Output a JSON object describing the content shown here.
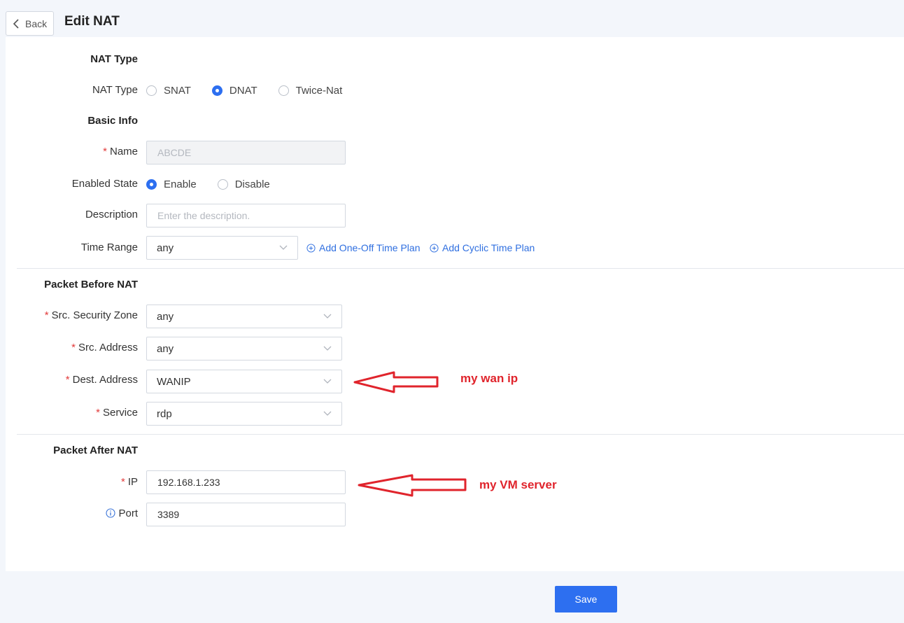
{
  "header": {
    "back_label": "Back",
    "title": "Edit NAT"
  },
  "nat_type_section": {
    "title": "NAT Type",
    "field_label": "NAT Type",
    "options": [
      "SNAT",
      "DNAT",
      "Twice-Nat"
    ],
    "selected": "DNAT"
  },
  "basic_info": {
    "title": "Basic Info",
    "name_label": "Name",
    "name_value": "ABCDE",
    "enabled_label": "Enabled State",
    "enabled_options": [
      "Enable",
      "Disable"
    ],
    "enabled_selected": "Enable",
    "description_label": "Description",
    "description_placeholder": "Enter the description.",
    "time_range_label": "Time Range",
    "time_range_value": "any",
    "add_one_off": "Add One-Off Time Plan",
    "add_cyclic": "Add Cyclic Time Plan"
  },
  "before_nat": {
    "title": "Packet Before NAT",
    "src_zone_label": "Src. Security Zone",
    "src_zone_value": "any",
    "src_address_label": "Src. Address",
    "src_address_value": "any",
    "dest_address_label": "Dest. Address",
    "dest_address_value": "WANIP",
    "service_label": "Service",
    "service_value": "rdp"
  },
  "after_nat": {
    "title": "Packet After NAT",
    "ip_label": "IP",
    "ip_value": "192.168.1.233",
    "port_label": "Port",
    "port_value": "3389"
  },
  "annotations": {
    "wan": "my wan ip",
    "vm": "my VM server"
  },
  "actions": {
    "save_label": "Save"
  },
  "colors": {
    "accent": "#2d6ff0",
    "required": "#e23b3b",
    "annotation": "#e0242c"
  }
}
